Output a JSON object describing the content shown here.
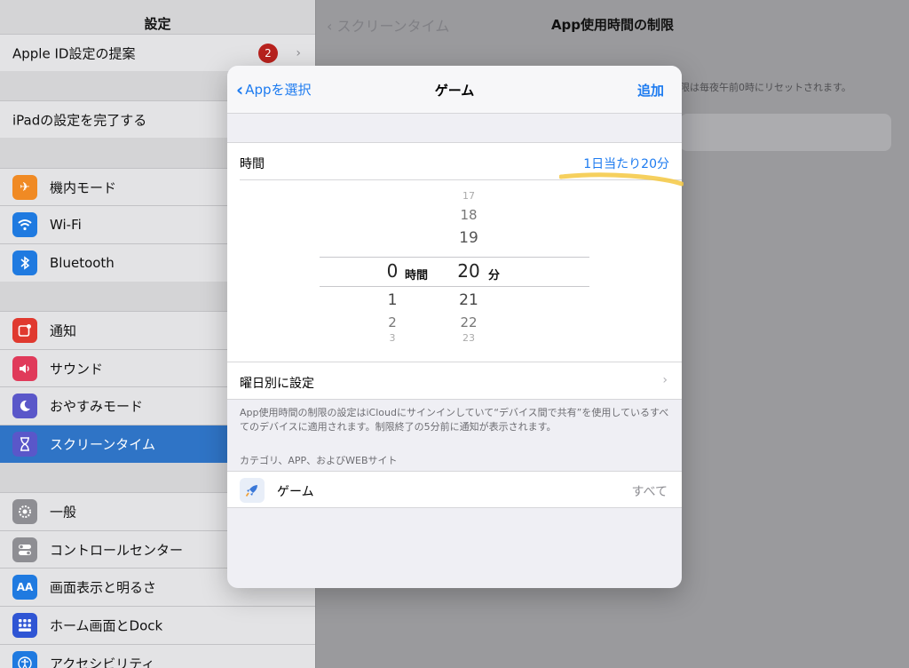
{
  "sidebar": {
    "title": "設定",
    "items": [
      {
        "label": "Apple ID設定の提案",
        "badge": "2"
      },
      {
        "label": "iPadの設定を完了する"
      },
      {
        "label": "機内モード",
        "icon": "airplane-icon",
        "color": "#f08a24"
      },
      {
        "label": "Wi-Fi",
        "icon": "wifi-icon",
        "color": "#1f7ae0"
      },
      {
        "label": "Bluetooth",
        "icon": "bluetooth-icon",
        "color": "#1f7ae0"
      },
      {
        "label": "通知",
        "icon": "notification-icon",
        "color": "#e0392f"
      },
      {
        "label": "サウンド",
        "icon": "speaker-icon",
        "color": "#e03a5a"
      },
      {
        "label": "おやすみモード",
        "icon": "moon-icon",
        "color": "#5a57c9"
      },
      {
        "label": "スクリーンタイム",
        "icon": "hourglass-icon",
        "color": "#5a57c9",
        "selected": true
      },
      {
        "label": "一般",
        "icon": "gear-icon",
        "color": "#8e8e93"
      },
      {
        "label": "コントロールセンター",
        "icon": "toggles-icon",
        "color": "#8e8e93"
      },
      {
        "label": "画面表示と明るさ",
        "icon": "text-size-icon",
        "color": "#1f7ae0"
      },
      {
        "label": "ホーム画面とDock",
        "icon": "grid-icon",
        "color": "#2f55d4"
      },
      {
        "label": "アクセシビリティ",
        "icon": "accessibility-icon",
        "color": "#1f7ae0"
      }
    ]
  },
  "detail": {
    "back_label": "スクリーンタイム",
    "title": "App使用時間の制限",
    "note": "限は毎夜午前0時にリセットされます。"
  },
  "modal": {
    "back_label": "Appを選択",
    "title": "ゲーム",
    "add_label": "追加",
    "time_label": "時間",
    "time_value": "1日当たり20分",
    "picker": {
      "hours": {
        "above": [
          "",
          ""
        ],
        "selected": "0",
        "below": [
          "1",
          "2",
          "3"
        ],
        "unit": "時間"
      },
      "minutes": {
        "above": [
          "17",
          "18",
          "19"
        ],
        "selected": "20",
        "below": [
          "21",
          "22",
          "23"
        ],
        "unit": "分"
      }
    },
    "weekday_label": "曜日別に設定",
    "footnote": "App使用時間の制限の設定はiCloudにサインインしていて“デバイス間で共有”を使用しているすべてのデバイスに適用されます。制限終了の5分前に通知が表示されます。",
    "section_header": "カテゴリ、APP、およびWEBサイト",
    "category": {
      "label": "ゲーム",
      "value": "すべて",
      "icon": "rocket-icon"
    }
  },
  "colors": {
    "accent": "#1d7bf0",
    "highlight": "#f5c842"
  }
}
